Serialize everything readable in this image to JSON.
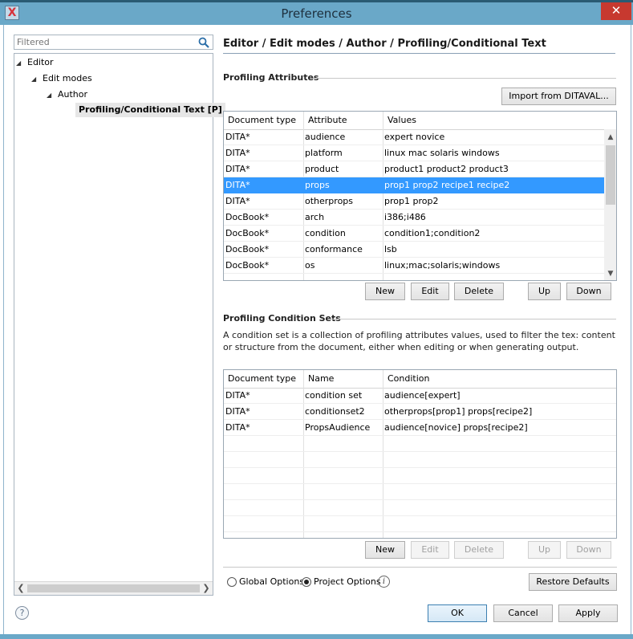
{
  "window": {
    "title": "Preferences",
    "close_symbol": "✕",
    "app_icon_letter": "X"
  },
  "sidebar": {
    "filter_placeholder": "Filtered",
    "tree": [
      {
        "label": "Editor"
      },
      {
        "label": "Edit modes"
      },
      {
        "label": "Author"
      },
      {
        "label": "Profiling/Conditional Text [P]",
        "selected": true
      }
    ]
  },
  "page": {
    "title": "Editor / Edit modes / Author / Profiling/Conditional Text"
  },
  "profiling_attributes": {
    "title": "Profiling Attributes",
    "import_label": "Import from DITAVAL...",
    "columns": [
      "Document type",
      "Attribute",
      "Values"
    ],
    "rows": [
      [
        "DITA*",
        "audience",
        "expert novice"
      ],
      [
        "DITA*",
        "platform",
        "linux mac solaris windows"
      ],
      [
        "DITA*",
        "product",
        "product1 product2 product3"
      ],
      [
        "DITA*",
        "props",
        "prop1 prop2 recipe1 recipe2"
      ],
      [
        "DITA*",
        "otherprops",
        "prop1 prop2"
      ],
      [
        "DocBook*",
        "arch",
        "i386;i486"
      ],
      [
        "DocBook*",
        "condition",
        "condition1;condition2"
      ],
      [
        "DocBook*",
        "conformance",
        "lsb"
      ],
      [
        "DocBook*",
        "os",
        "linux;mac;solaris;windows"
      ]
    ],
    "selected_row": 3,
    "buttons": {
      "new": "New",
      "edit": "Edit",
      "delete": "Delete",
      "up": "Up",
      "down": "Down"
    }
  },
  "condition_sets": {
    "title": "Profiling Condition Sets",
    "description": "A condition set is a collection of profiling attributes values, used to filter the tex: content or structure from the document, either when editing or when generating output.",
    "columns": [
      "Document type",
      "Name",
      "Condition"
    ],
    "rows": [
      [
        "DITA*",
        "condition set",
        "audience[expert]"
      ],
      [
        "DITA*",
        "conditionset2",
        "otherprops[prop1] props[recipe2]"
      ],
      [
        "DITA*",
        "PropsAudience",
        "audience[novice] props[recipe2]"
      ]
    ],
    "buttons": {
      "new": "New",
      "edit": "Edit",
      "delete": "Delete",
      "up": "Up",
      "down": "Down"
    }
  },
  "footer": {
    "global_options": "Global Options",
    "project_options": "Project Options",
    "selected_option": "project",
    "restore_defaults": "Restore Defaults",
    "ok": "OK",
    "cancel": "Cancel",
    "apply": "Apply",
    "help_symbol": "?"
  },
  "colors": {
    "selection": "#3399ff",
    "titlebar": "#6aa8c8",
    "close": "#c7392f"
  }
}
